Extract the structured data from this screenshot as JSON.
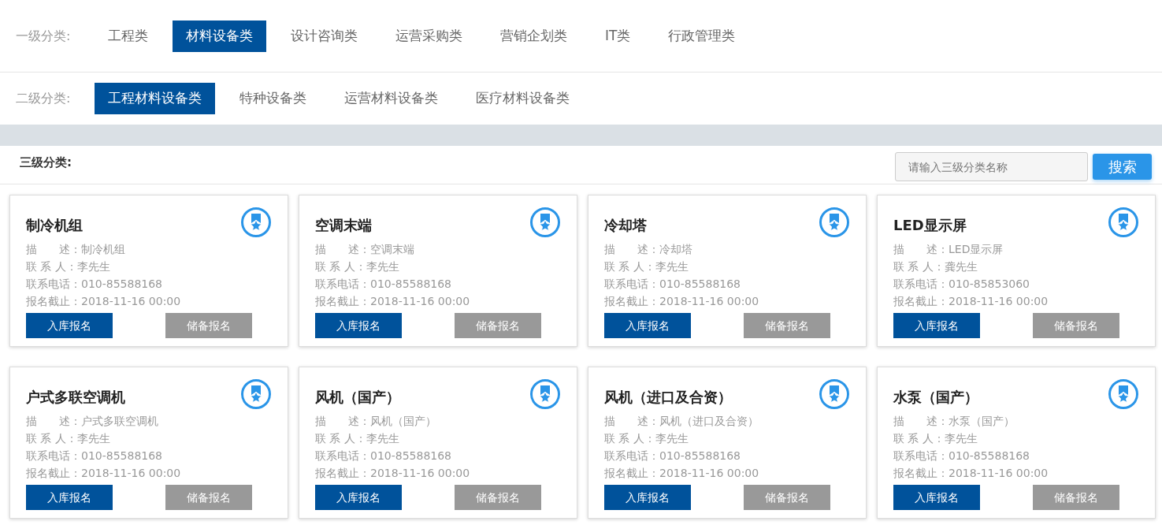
{
  "level1": {
    "label": "一级分类:",
    "tabs": [
      {
        "label": "工程类",
        "selected": false
      },
      {
        "label": "材料设备类",
        "selected": true
      },
      {
        "label": "设计咨询类",
        "selected": false
      },
      {
        "label": "运营采购类",
        "selected": false
      },
      {
        "label": "营销企划类",
        "selected": false
      },
      {
        "label": "IT类",
        "selected": false
      },
      {
        "label": "行政管理类",
        "selected": false
      }
    ]
  },
  "level2": {
    "label": "二级分类:",
    "tabs": [
      {
        "label": "工程材料设备类",
        "selected": true
      },
      {
        "label": "特种设备类",
        "selected": false
      },
      {
        "label": "运营材料设备类",
        "selected": false
      },
      {
        "label": "医疗材料设备类",
        "selected": false
      }
    ]
  },
  "level3": {
    "label": "三级分类:",
    "search": {
      "placeholder": "请输入三级分类名称",
      "button": "搜索"
    }
  },
  "cards": [
    {
      "title": "制冷机组",
      "fields": [
        {
          "label": "描　　述：",
          "value": "制冷机组"
        },
        {
          "label": "联 系 人：",
          "value": "李先生"
        },
        {
          "label": "联系电话：",
          "value": "010-85588168"
        },
        {
          "label": "报名截止：",
          "value": "2018-11-16 00:00"
        }
      ],
      "buttons": [
        "入库报名",
        "储备报名"
      ]
    },
    {
      "title": "空调末端",
      "fields": [
        {
          "label": "描　　述：",
          "value": "空调末端"
        },
        {
          "label": "联 系 人：",
          "value": "李先生"
        },
        {
          "label": "联系电话：",
          "value": "010-85588168"
        },
        {
          "label": "报名截止：",
          "value": "2018-11-16 00:00"
        }
      ],
      "buttons": [
        "入库报名",
        "储备报名"
      ]
    },
    {
      "title": "冷却塔",
      "fields": [
        {
          "label": "描　　述：",
          "value": "冷却塔"
        },
        {
          "label": "联 系 人：",
          "value": "李先生"
        },
        {
          "label": "联系电话：",
          "value": "010-85588168"
        },
        {
          "label": "报名截止：",
          "value": "2018-11-16 00:00"
        }
      ],
      "buttons": [
        "入库报名",
        "储备报名"
      ]
    },
    {
      "title": "LED显示屏",
      "fields": [
        {
          "label": "描　　述：",
          "value": "LED显示屏"
        },
        {
          "label": "联 系 人：",
          "value": "龚先生"
        },
        {
          "label": "联系电话：",
          "value": "010-85853060"
        },
        {
          "label": "报名截止：",
          "value": "2018-11-16 00:00"
        }
      ],
      "buttons": [
        "入库报名",
        "储备报名"
      ]
    },
    {
      "title": "户式多联空调机",
      "fields": [
        {
          "label": "描　　述：",
          "value": "户式多联空调机"
        },
        {
          "label": "联 系 人：",
          "value": "李先生"
        },
        {
          "label": "联系电话：",
          "value": "010-85588168"
        },
        {
          "label": "报名截止：",
          "value": "2018-11-16 00:00"
        }
      ],
      "buttons": [
        "入库报名",
        "储备报名"
      ]
    },
    {
      "title": "风机（国产）",
      "fields": [
        {
          "label": "描　　述：",
          "value": "风机（国产）"
        },
        {
          "label": "联 系 人：",
          "value": "李先生"
        },
        {
          "label": "联系电话：",
          "value": "010-85588168"
        },
        {
          "label": "报名截止：",
          "value": "2018-11-16 00:00"
        }
      ],
      "buttons": [
        "入库报名",
        "储备报名"
      ]
    },
    {
      "title": "风机（进口及合资）",
      "fields": [
        {
          "label": "描　　述：",
          "value": "风机（进口及合资）"
        },
        {
          "label": "联 系 人：",
          "value": "李先生"
        },
        {
          "label": "联系电话：",
          "value": "010-85588168"
        },
        {
          "label": "报名截止：",
          "value": "2018-11-16 00:00"
        }
      ],
      "buttons": [
        "入库报名",
        "储备报名"
      ]
    },
    {
      "title": "水泵（国产）",
      "fields": [
        {
          "label": "描　　述：",
          "value": "水泵（国产）"
        },
        {
          "label": "联 系 人：",
          "value": "李先生"
        },
        {
          "label": "联系电话：",
          "value": "010-85588168"
        },
        {
          "label": "报名截止：",
          "value": "2018-11-16 00:00"
        }
      ],
      "buttons": [
        "入库报名",
        "储备报名"
      ]
    }
  ]
}
